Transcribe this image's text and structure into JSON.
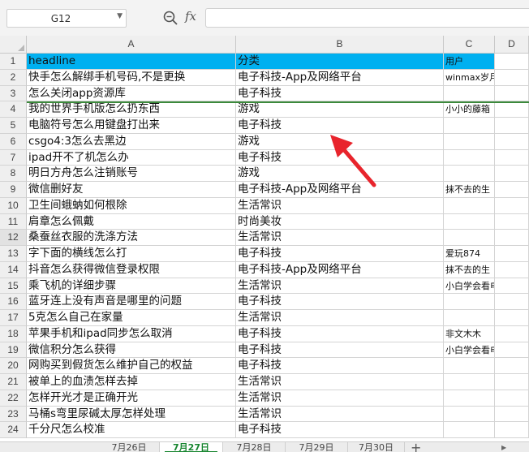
{
  "toolbar": {
    "cell_ref": "G12",
    "fx_label": "fx",
    "formula_value": ""
  },
  "columns": [
    {
      "letter": "A",
      "selected": false
    },
    {
      "letter": "B",
      "selected": false
    },
    {
      "letter": "C",
      "selected": false
    },
    {
      "letter": "D",
      "selected": false
    }
  ],
  "selected_row": 12,
  "header_row": [
    "headline",
    "分类",
    "用户"
  ],
  "header_fill": "#00b0f0",
  "rows": [
    [
      "快手怎么解绑手机号码,不是更换",
      "电子科技-App及网络平台",
      "winmax岁月"
    ],
    [
      "怎么关闭app资源库",
      "电子科技",
      ""
    ],
    [
      "我的世界手机版怎么扔东西",
      "游戏",
      "小小的藤箱"
    ],
    [
      "电脑符号怎么用键盘打出来",
      "电子科技",
      ""
    ],
    [
      "csgo4:3怎么去黑边",
      "游戏",
      ""
    ],
    [
      "ipad开不了机怎么办",
      "电子科技",
      ""
    ],
    [
      "明日方舟怎么注销账号",
      "游戏",
      ""
    ],
    [
      "微信删好友",
      "电子科技-App及网络平台",
      "抹不去的生"
    ],
    [
      "卫生间蛾蚋如何根除",
      "生活常识",
      ""
    ],
    [
      "肩章怎么佩戴",
      "时尚美妆",
      ""
    ],
    [
      "桑蚕丝衣服的洗涤方法",
      "生活常识",
      ""
    ],
    [
      "字下面的横线怎么打",
      "电子科技",
      "爱玩874"
    ],
    [
      "抖音怎么获得微信登录权限",
      "电子科技-App及网络平台",
      "抹不去的生"
    ],
    [
      "乘飞机的详细步骤",
      "生活常识",
      "小白学会看电脑"
    ],
    [
      "蓝牙连上没有声音是哪里的问题",
      "电子科技",
      ""
    ],
    [
      "5克怎么自己在家量",
      "生活常识",
      ""
    ],
    [
      "苹果手机和ipad同步怎么取消",
      "电子科技",
      "非文木木"
    ],
    [
      "微信积分怎么获得",
      "电子科技",
      "小白学会看电脑"
    ],
    [
      "网购买到假货怎么维护自己的权益",
      "电子科技",
      ""
    ],
    [
      "被单上的血渍怎样去掉",
      "生活常识",
      ""
    ],
    [
      "怎样开光才是正确开光",
      "生活常识",
      ""
    ],
    [
      "马桶s弯里尿碱太厚怎样处理",
      "生活常识",
      ""
    ],
    [
      "千分尺怎么校准",
      "电子科技",
      ""
    ]
  ],
  "sheet_tabs": [
    {
      "label": "7月26日",
      "active": false
    },
    {
      "label": "7月27日",
      "active": true
    },
    {
      "label": "7月28日",
      "active": false
    },
    {
      "label": "7月29日",
      "active": false
    },
    {
      "label": "7月30日",
      "active": false
    }
  ],
  "add_sheet_label": "+",
  "accent_color": "#17852f",
  "annotation_color": "#e8242c",
  "icons": {
    "zoom": "zoom-icon",
    "namebox_dropdown": "chevron-down-icon",
    "annotation": "arrow-icon"
  }
}
